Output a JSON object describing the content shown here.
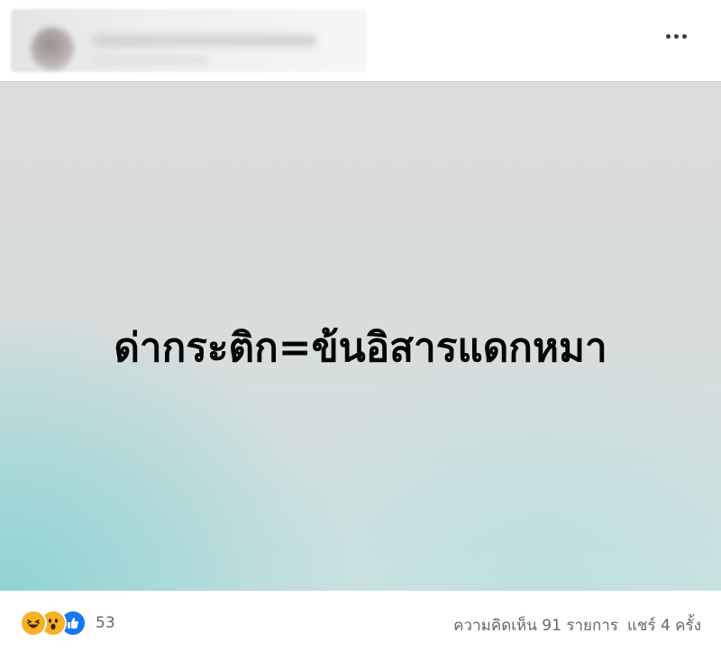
{
  "post": {
    "text": "ด่ากระติก=ข้นอิสารแดกหมา",
    "more_icon": "more-horizontal-icon"
  },
  "reactions": {
    "icons": [
      "haha-emoji-icon",
      "wow-emoji-icon",
      "like-thumb-icon"
    ],
    "count": "53"
  },
  "stats": {
    "comments": "ความคิดเห็น 91 รายการ",
    "shares": "แชร์ 4 ครั้ง"
  },
  "colors": {
    "like": "#1877f2",
    "emoji": "#f7b125",
    "text_muted": "#65676b"
  }
}
